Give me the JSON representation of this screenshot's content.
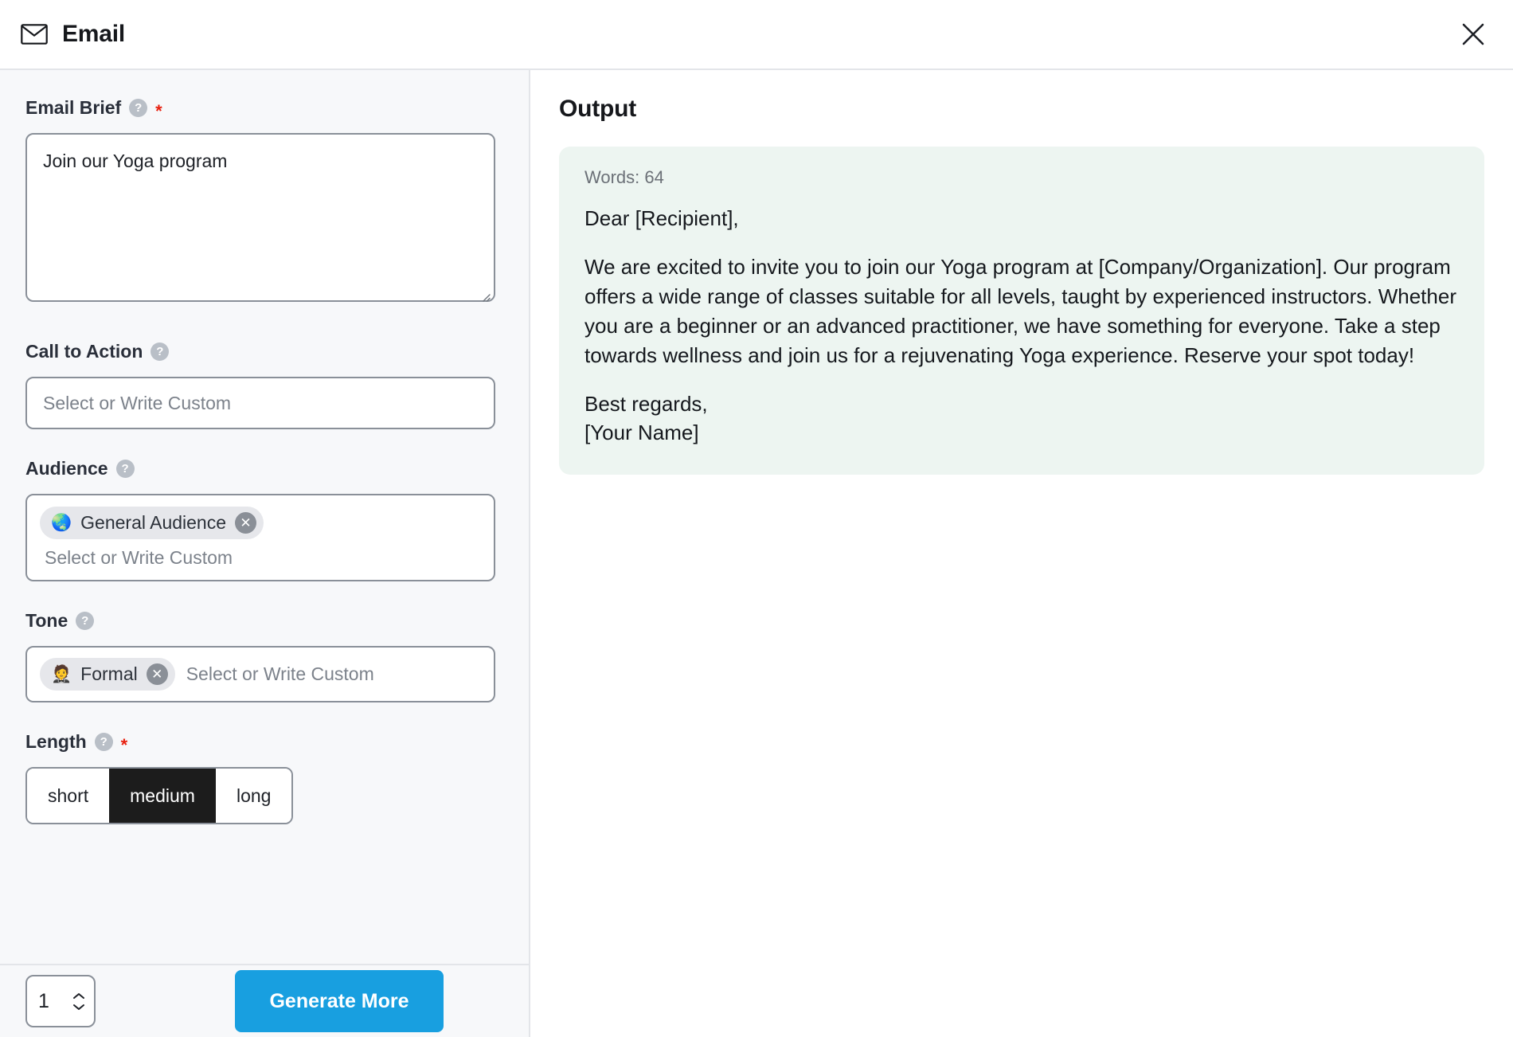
{
  "header": {
    "title": "Email",
    "icon": "envelope-icon",
    "close_label": "close-icon"
  },
  "form": {
    "email_brief": {
      "label": "Email Brief",
      "help": "?",
      "required": "*",
      "value": "Join our Yoga program",
      "placeholder": ""
    },
    "call_to_action": {
      "label": "Call to Action",
      "help": "?",
      "placeholder": "Select or Write Custom",
      "value": ""
    },
    "audience": {
      "label": "Audience",
      "help": "?",
      "placeholder": "Select or Write Custom",
      "chips": [
        {
          "emoji": "🌏",
          "label": "General Audience",
          "remove": "✕"
        }
      ]
    },
    "tone": {
      "label": "Tone",
      "help": "?",
      "placeholder": "Select or Write Custom",
      "chips": [
        {
          "emoji": "🤵",
          "label": "Formal",
          "remove": "✕"
        }
      ]
    },
    "length": {
      "label": "Length",
      "help": "?",
      "required": "*",
      "options": [
        "short",
        "medium",
        "long"
      ],
      "selected": "medium"
    }
  },
  "footer": {
    "count_value": "1",
    "generate_label": "Generate More"
  },
  "output": {
    "title": "Output",
    "word_count_label": "Words: 64",
    "greeting": "Dear [Recipient],",
    "paragraph": "We are excited to invite you to join our Yoga program at [Company/Organization]. Our program offers a wide range of classes suitable for all levels, taught by experienced instructors. Whether you are a beginner or an advanced practitioner, we have something for everyone. Take a step towards wellness and join us for a rejuvenating Yoga experience. Reserve your spot today!",
    "sign_off": "Best regards,",
    "signature": "[Your Name]"
  },
  "colors": {
    "accent_blue": "#189fe0",
    "output_card_bg": "#edf5f1",
    "panel_bg": "#f7f8fa",
    "required_red": "#e8200f",
    "segment_active_bg": "#1c1c1c"
  }
}
